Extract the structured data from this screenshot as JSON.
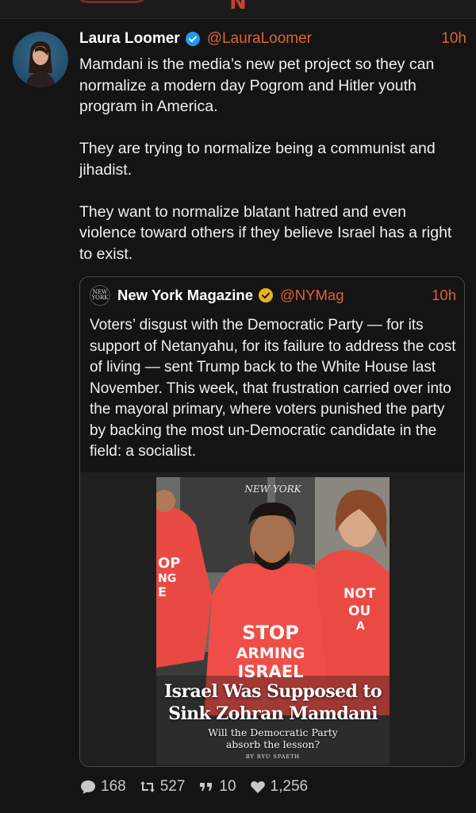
{
  "post": {
    "author_name": "Laura Loomer",
    "author_handle": "@LauraLoomer",
    "time": "10h",
    "paragraphs": [
      "Mamdani is the media’s new pet project so they can normalize a modern day Pogrom and Hitler youth program in America.",
      "They are trying to normalize being a communist and jihadist.",
      "They want to normalize blatant hatred and even violence toward others if they believe Israel has a right to exist."
    ]
  },
  "quote": {
    "logo_text": "NEW YORK",
    "author_name": "New York Magazine",
    "author_handle": "@NYMag",
    "time": "10h",
    "text": "Voters’ disgust with the Democratic Party — for its support of Netanyahu, for its failure to address the cost of living — sent Trump back to the White House last November. This week, that frustration carried over into the mayoral primary, where voters punished the party by backing the most un-Democratic candidate in the field: a socialist.",
    "cover": {
      "masthead": "NEW YORK",
      "headline_line1": "Israel Was Supposed to",
      "headline_line2": "Sink Zohran Mamdani",
      "dek_line1": "Will the Democratic Party",
      "dek_line2": "absorb the lesson?",
      "byline": "BY RYU SPAETH",
      "shirt_text_center": [
        "STOP",
        "ARMING",
        "ISRAEL"
      ],
      "shirt_text_left": [
        "OP",
        "NG",
        "E"
      ],
      "shirt_text_right": [
        "NOT",
        "OU",
        "A"
      ]
    }
  },
  "actions": {
    "replies": "168",
    "reposts": "527",
    "quotes": "10",
    "likes": "1,256"
  },
  "colors": {
    "background": "#141414",
    "accent": "#e0603a",
    "verified_blue": "#1d9bf0",
    "verified_gold": "#e8b21e"
  }
}
